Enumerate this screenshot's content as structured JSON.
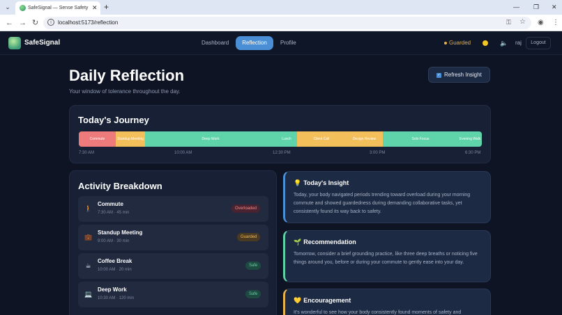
{
  "browser": {
    "tab_title": "SafeSignal — Sense Safety Befo",
    "url": "localhost:5173/reflection",
    "new_tab": "+",
    "close_tab": "✕",
    "menu": "⌄",
    "minimize": "—",
    "restore": "❐",
    "close_window": "✕",
    "back": "←",
    "forward": "→",
    "reload": "↻",
    "info": "i",
    "key": "⚿",
    "star": "☆",
    "profile": "◉",
    "more": "⋮"
  },
  "header": {
    "brand": "SafeSignal",
    "nav": [
      {
        "label": "Dashboard",
        "active": false
      },
      {
        "label": "Reflection",
        "active": true
      },
      {
        "label": "Profile",
        "active": false
      }
    ],
    "state_label": "Guarded",
    "speaker": "🔈",
    "user": "raj",
    "logout": "Logout"
  },
  "page": {
    "title": "Daily Reflection",
    "subtitle": "Your window of tolerance throughout the day.",
    "refresh_label": "Refresh Insight"
  },
  "journey": {
    "title": "Today's Journey",
    "segments": [
      {
        "label": "Commute",
        "color": "#ee7b7b",
        "fraction": 0.092
      },
      {
        "label": "Standup Meeting",
        "color": "#f3bf5a",
        "fraction": 0.072
      },
      {
        "label": "Deep Work",
        "color": "#5fd3a9",
        "fraction": 0.325
      },
      {
        "label": "Lunch",
        "color": "#5fd3a9",
        "fraction": 0.052
      },
      {
        "label": "Client Call",
        "color": "#f3bf5a",
        "fraction": 0.121
      },
      {
        "label": "Design Review",
        "color": "#f3bf5a",
        "fraction": 0.092
      },
      {
        "label": "Solo Focus",
        "color": "#5fd3a9",
        "fraction": 0.186
      },
      {
        "label": "Evening Walk",
        "color": "#5fd3a9",
        "fraction": 0.06
      }
    ],
    "ticks": [
      "7:30 AM",
      "10:00 AM",
      "12:30 PM",
      "3:00 PM",
      "6:30 PM"
    ]
  },
  "activity": {
    "title": "Activity Breakdown",
    "items": [
      {
        "name": "Commute",
        "meta": "7:30 AM · 45 min",
        "status": "Overloaded",
        "icon": "🚶"
      },
      {
        "name": "Standup Meeting",
        "meta": "9:00 AM · 30 min",
        "status": "Guarded",
        "icon": "💼"
      },
      {
        "name": "Coffee Break",
        "meta": "10:00 AM · 20 min",
        "status": "Safe",
        "icon": "☕"
      },
      {
        "name": "Deep Work",
        "meta": "10:30 AM · 120 min",
        "status": "Safe",
        "icon": "💻"
      }
    ]
  },
  "insights": {
    "todays_insight": {
      "icon": "💡",
      "title": "Today's Insight",
      "body": "Today, your body navigated periods trending toward overload during your morning commute and showed guardedness during demanding collaborative tasks, yet consistently found its way back to safety."
    },
    "recommendation": {
      "icon": "🌱",
      "title": "Recommendation",
      "body": "Tomorrow, consider a brief grounding practice, like three deep breaths or noticing five things around you, before or during your commute to gently ease into your day."
    },
    "encouragement": {
      "icon": "💛",
      "title": "Encouragement",
      "body": "It's wonderful to see how your body consistently found moments of safety and"
    }
  }
}
